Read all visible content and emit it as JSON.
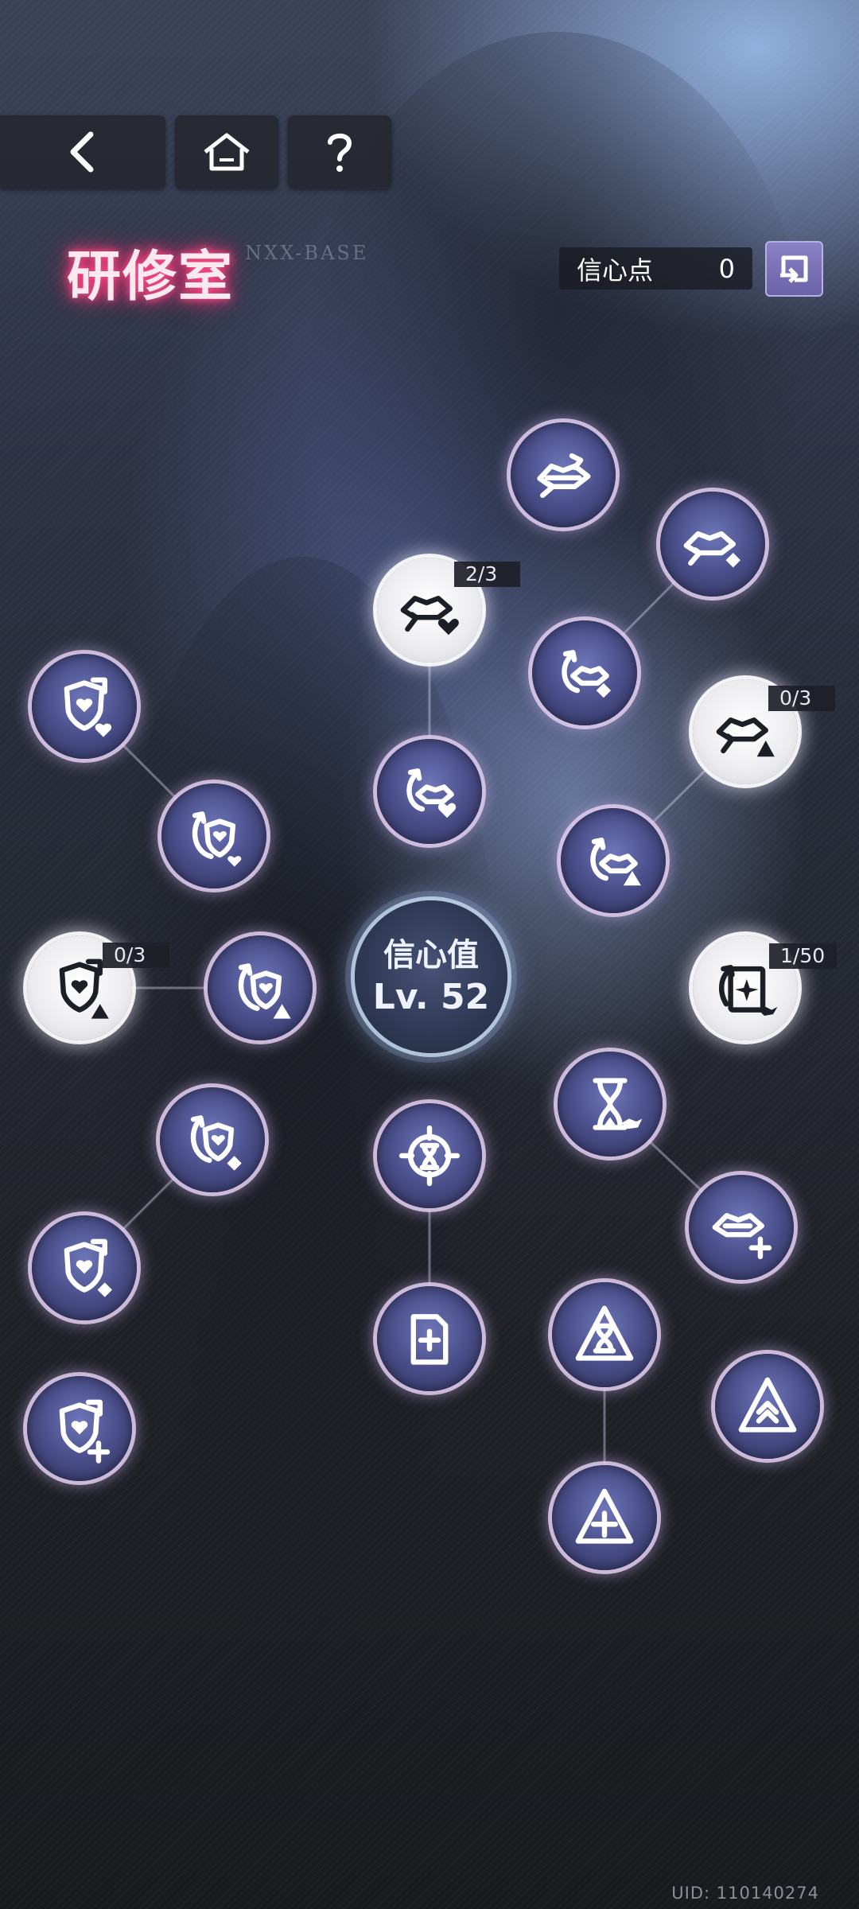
{
  "header": {
    "title": "研修室",
    "subtitle": "NXX-BASE",
    "points_label": "信心点",
    "points_value": "0"
  },
  "center": {
    "label": "信心值",
    "level": "Lv. 52"
  },
  "counters": {
    "node_2": "2/3",
    "node_5": "0/3",
    "node_10": "0/3",
    "node_12": "1/50"
  },
  "footer": {
    "uid": "UID: 110140274"
  },
  "icons": {
    "back": "chevron-left-icon",
    "home": "home-icon",
    "help": "question-icon",
    "exchange": "exchange-icon"
  },
  "colors": {
    "title_glow": "#ff2e72",
    "node_fill": "#4a4f8a",
    "node_lit": "#ececf0",
    "exchange_button": "#7a72b6"
  }
}
